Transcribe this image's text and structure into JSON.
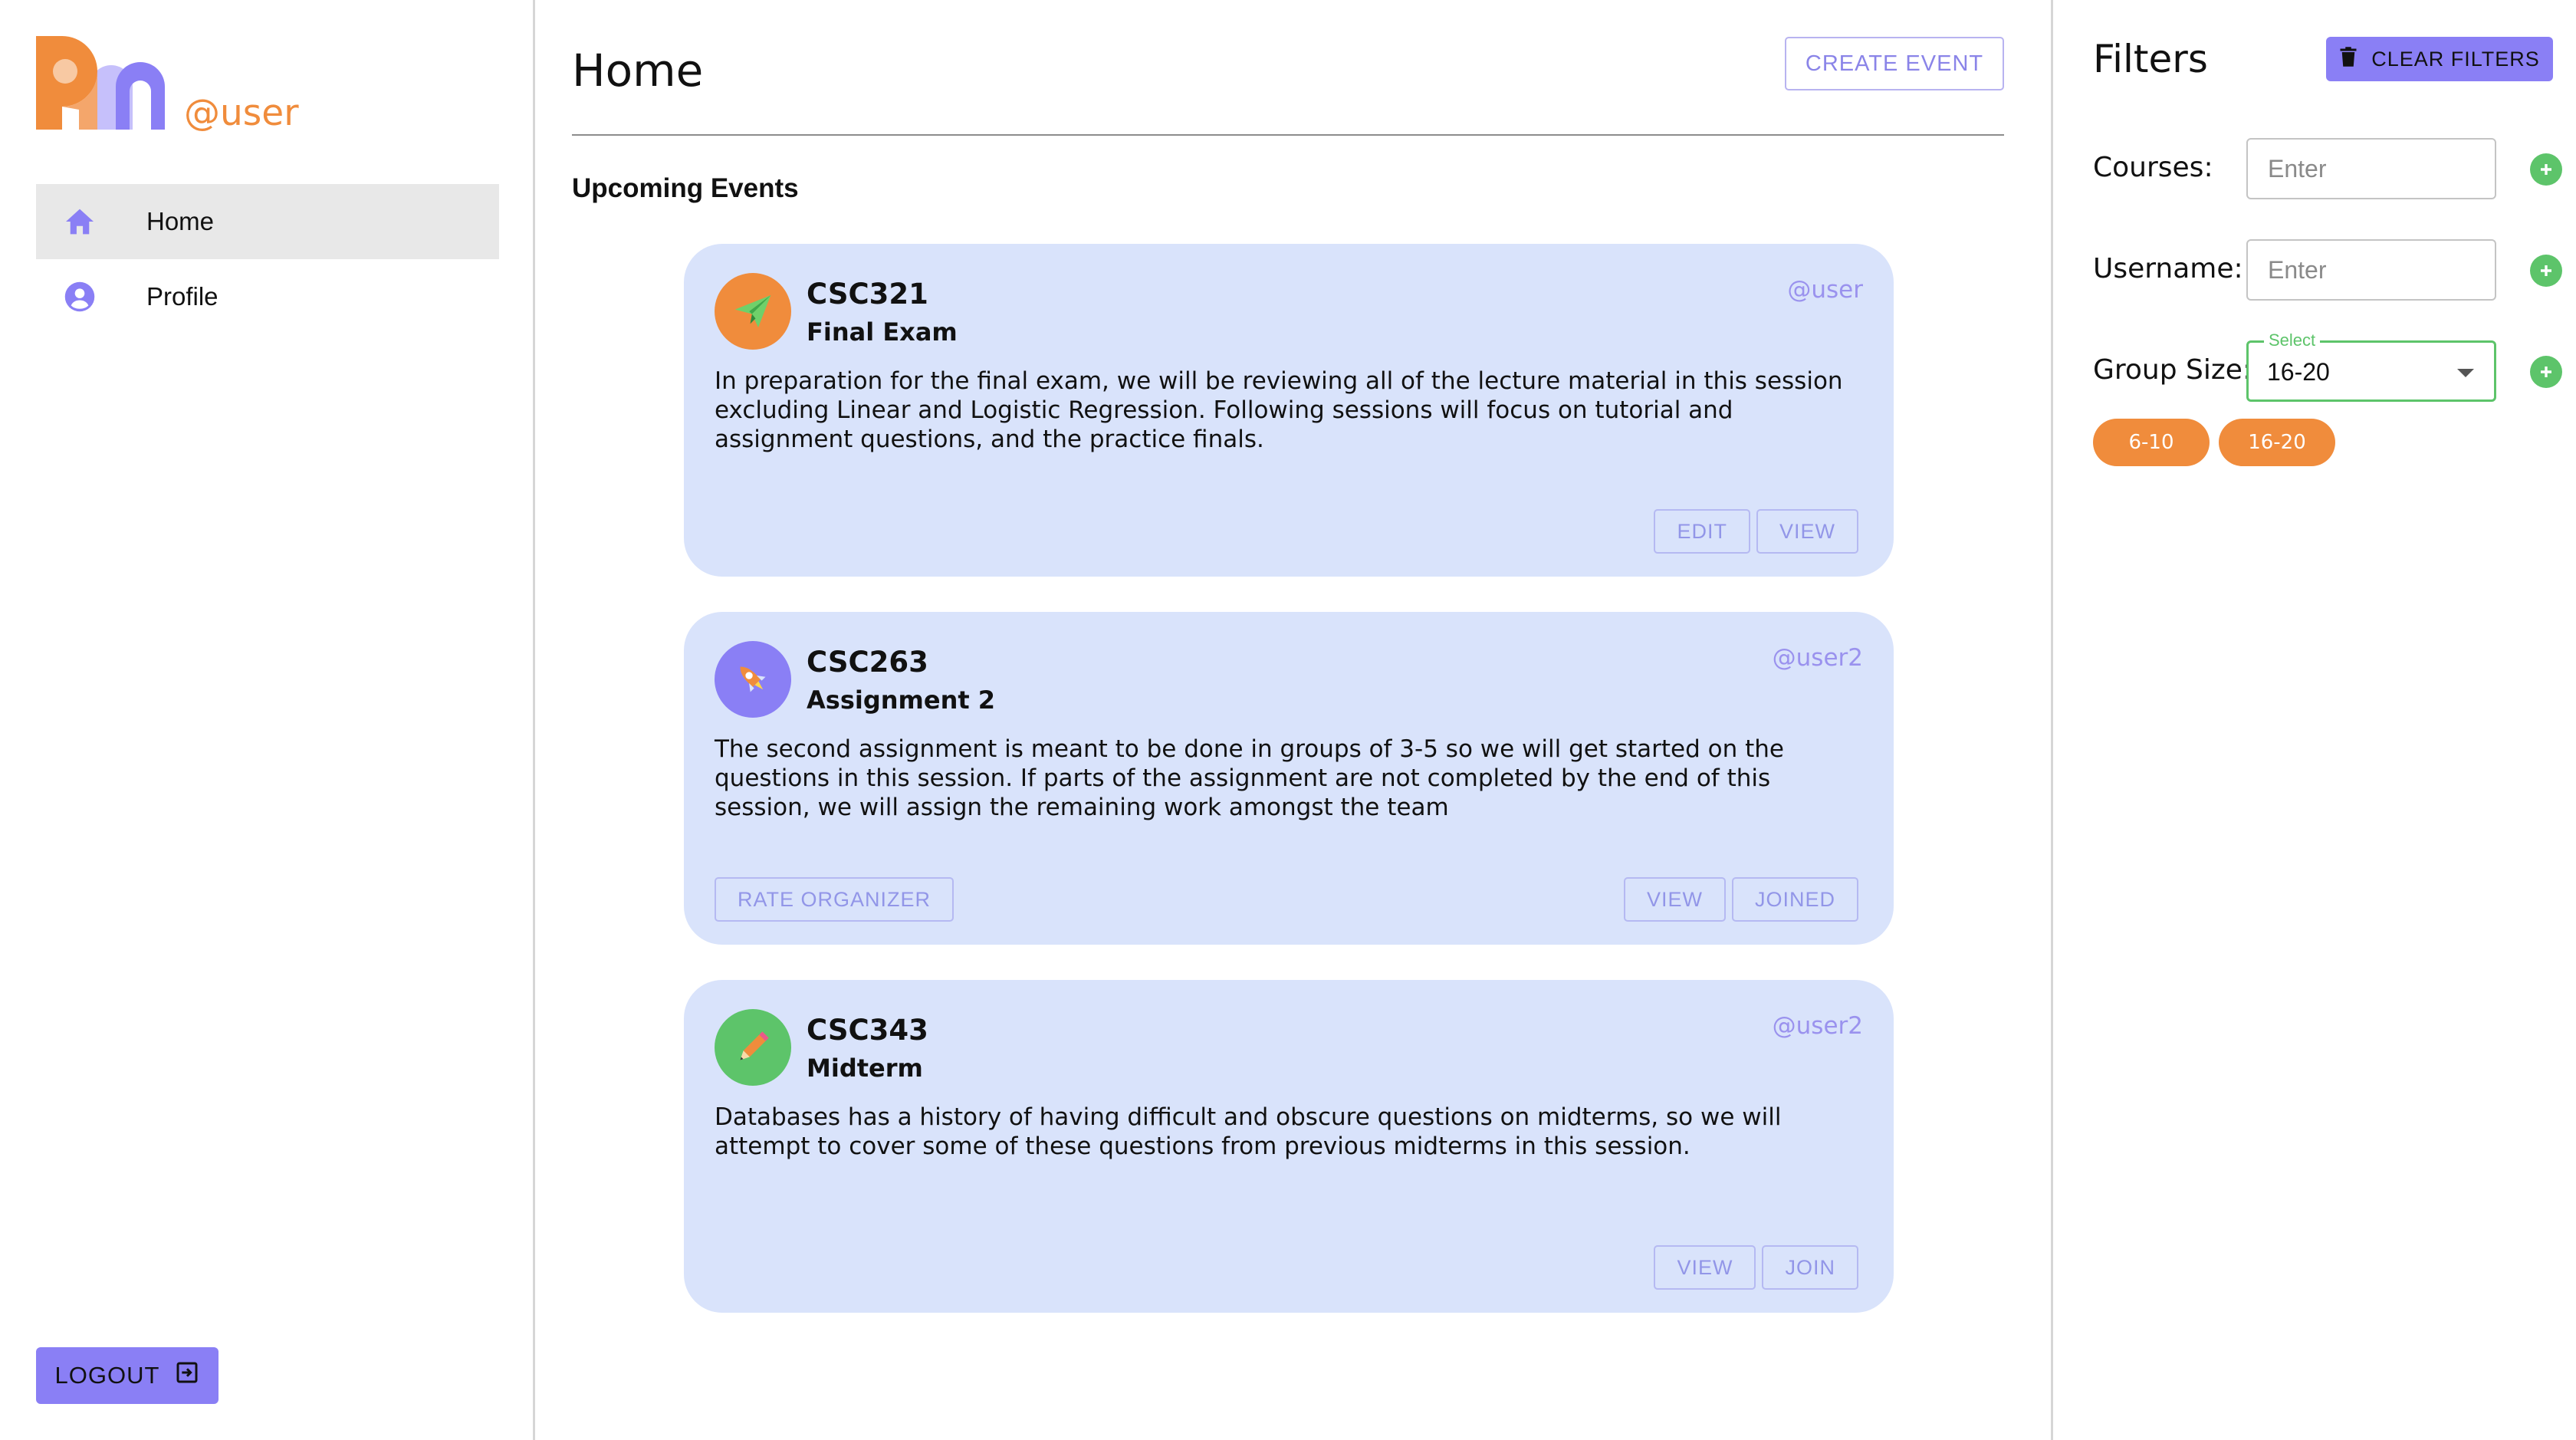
{
  "sidebar": {
    "username": "@user",
    "nav": [
      {
        "label": "Home",
        "icon": "home-icon"
      },
      {
        "label": "Profile",
        "icon": "account-circle-icon"
      }
    ],
    "logout_label": "LOGOUT",
    "logout_icon": "exit-icon"
  },
  "main": {
    "title": "Home",
    "create_label": "CREATE EVENT",
    "section_title": "Upcoming Events",
    "events": [
      {
        "course": "CSC321",
        "subtitle": "Final Exam",
        "user": "@user",
        "icon": "paper-plane-icon",
        "icon_color": "#f08c3c",
        "description": "In preparation for the final exam, we will be reviewing all of the lecture material in this session excluding Linear and Logistic Regression. Following sessions will focus on tutorial and assignment questions, and the practice finals.",
        "actions": [
          "EDIT",
          "VIEW"
        ]
      },
      {
        "course": "CSC263",
        "subtitle": "Assignment 2",
        "user": "@user2",
        "icon": "rocket-icon",
        "icon_color": "#8a7ff5",
        "description": "The second assignment is meant to be done in groups of 3-5 so we will get started on the questions in this session. If parts of the assignment are not completed by the end of this session, we will assign the remaining work amongst the team",
        "left_action": "RATE ORGANIZER",
        "actions": [
          "VIEW",
          "JOINED"
        ]
      },
      {
        "course": "CSC343",
        "subtitle": "Midterm",
        "user": "@user2",
        "icon": "pencil-icon",
        "icon_color": "#5dc46a",
        "description": "Databases has a history of having difficult and obscure questions on midterms, so we will attempt to cover some of these questions from previous midterms in this session.",
        "actions": [
          "VIEW",
          "JOIN"
        ]
      }
    ]
  },
  "filters": {
    "title": "Filters",
    "clear_label": "CLEAR FILTERS",
    "courses_label": "Courses:",
    "courses_placeholder": "Enter",
    "username_label": "Username:",
    "username_placeholder": "Enter",
    "group_size_label": "Group Size:",
    "group_size_legend": "Select",
    "group_size_value": "16-20",
    "chips": [
      "6-10",
      "16-20"
    ]
  },
  "colors": {
    "accent_purple": "#8a7ff5",
    "accent_orange": "#f08c3c",
    "accent_green": "#5dc46a",
    "card_bg": "#d9e3fb"
  }
}
